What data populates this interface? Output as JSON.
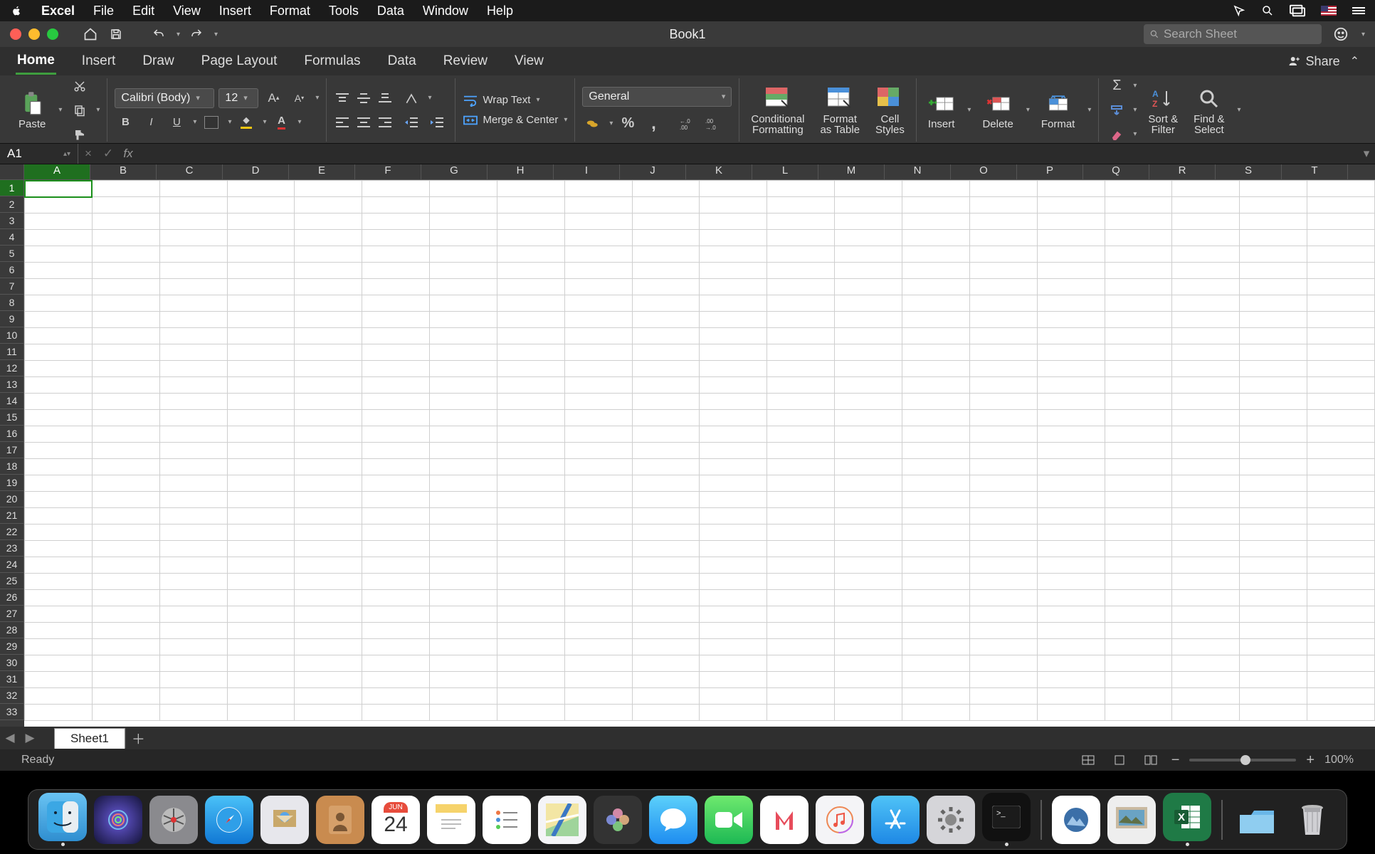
{
  "menubar": {
    "app": "Excel",
    "items": [
      "File",
      "Edit",
      "View",
      "Insert",
      "Format",
      "Tools",
      "Data",
      "Window",
      "Help"
    ]
  },
  "titlebar": {
    "title": "Book1",
    "search_placeholder": "Search Sheet"
  },
  "ribbon_tabs": {
    "items": [
      "Home",
      "Insert",
      "Draw",
      "Page Layout",
      "Formulas",
      "Data",
      "Review",
      "View"
    ],
    "active": "Home",
    "share": "Share"
  },
  "ribbon": {
    "paste": "Paste",
    "font_name": "Calibri (Body)",
    "font_size": "12",
    "wrap": "Wrap Text",
    "merge": "Merge & Center",
    "number_format": "General",
    "cond_fmt": "Conditional\nFormatting",
    "fmt_table": "Format\nas Table",
    "cell_styles": "Cell\nStyles",
    "insert": "Insert",
    "delete": "Delete",
    "format": "Format",
    "sort": "Sort &\nFilter",
    "find": "Find &\nSelect"
  },
  "formula_bar": {
    "cell_ref": "A1",
    "fx": "fx",
    "value": ""
  },
  "grid": {
    "columns": [
      "A",
      "B",
      "C",
      "D",
      "E",
      "F",
      "G",
      "H",
      "I",
      "J",
      "K",
      "L",
      "M",
      "N",
      "O",
      "P",
      "Q",
      "R",
      "S",
      "T"
    ],
    "rows": 33,
    "active_col": "A",
    "active_row": 1
  },
  "sheets": {
    "active": "Sheet1"
  },
  "status": {
    "msg": "Ready",
    "zoom": "100%"
  },
  "dock": {
    "calendar_day": "24",
    "calendar_month": "JUN"
  }
}
